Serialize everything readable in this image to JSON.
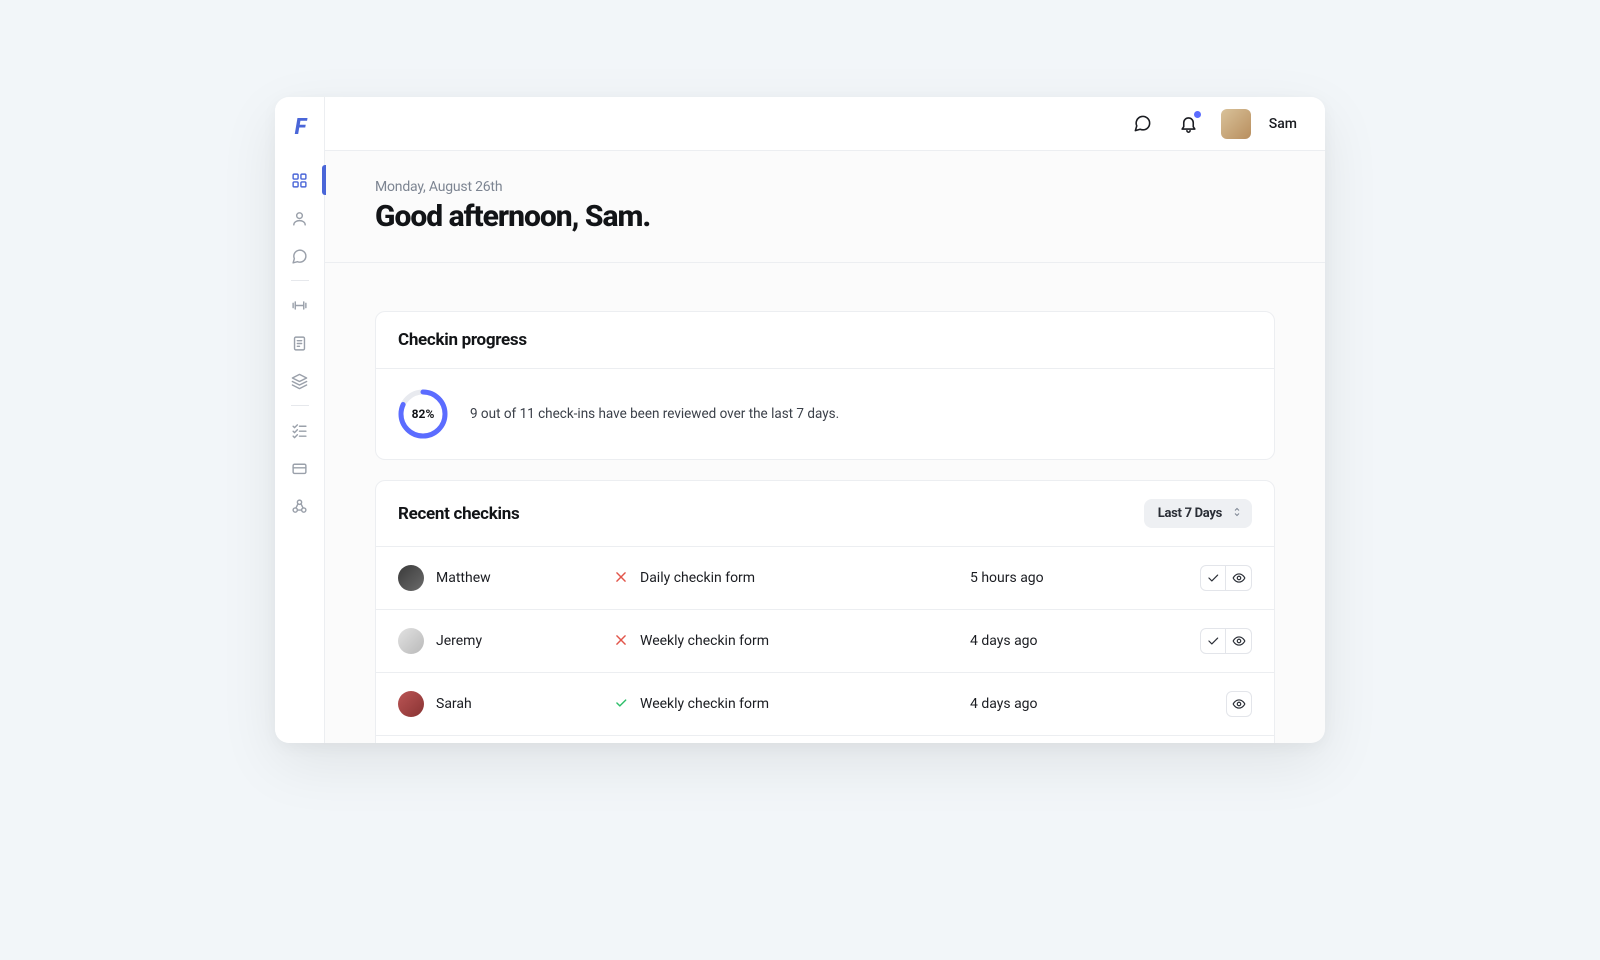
{
  "header": {
    "username": "Sam",
    "has_notification": true
  },
  "page": {
    "date": "Monday, August 26th",
    "greeting": "Good afternoon, Sam."
  },
  "checkin_progress": {
    "title": "Checkin progress",
    "percent_label": "82%",
    "percent_value": 82,
    "description": "9 out of 11 check-ins have been reviewed over the last 7 days."
  },
  "recent_checkins": {
    "title": "Recent checkins",
    "filter_selected": "Last 7 Days",
    "rows": [
      {
        "name": "Matthew",
        "form": "Daily checkin form",
        "status": "unreviewed",
        "time": "5 hours ago",
        "show_approve": true
      },
      {
        "name": "Jeremy",
        "form": "Weekly checkin form",
        "status": "unreviewed",
        "time": "4 days ago",
        "show_approve": true
      },
      {
        "name": "Sarah",
        "form": "Weekly checkin form",
        "status": "reviewed",
        "time": "4 days ago",
        "show_approve": false
      }
    ]
  }
}
